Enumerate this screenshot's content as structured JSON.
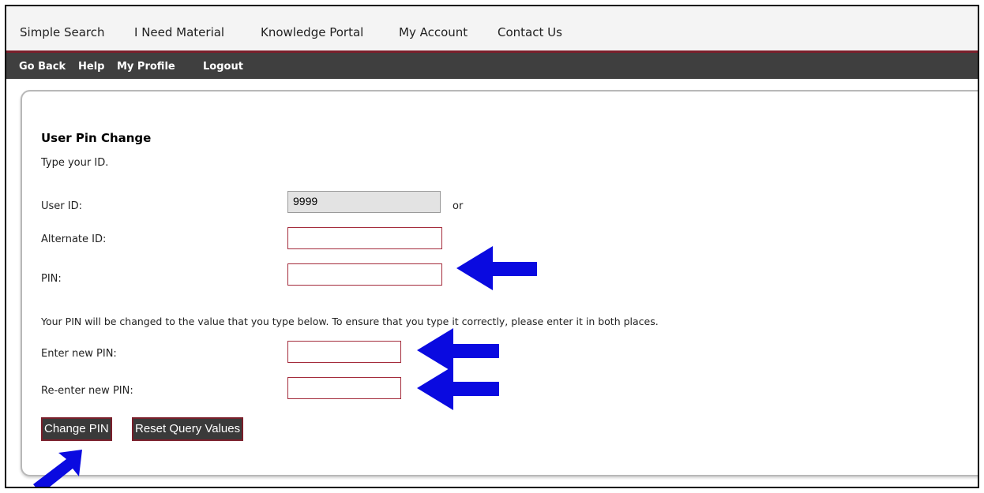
{
  "top_nav": [
    "Simple Search",
    "I Need Material",
    "Knowledge Portal",
    "My Account",
    "Contact Us"
  ],
  "sub_nav": [
    "Go Back",
    "Help",
    "My Profile",
    "Logout"
  ],
  "form": {
    "title": "User Pin Change",
    "instruction": "Type your ID.",
    "user_id_label": "User ID:",
    "user_id_value": "9999",
    "or_text": "or",
    "alternate_id_label": "Alternate ID:",
    "pin_label": "PIN:",
    "change_note": "Your PIN will be changed to the value that you type below. To ensure that you type it correctly, please enter it in both places.",
    "new_pin_label": "Enter new PIN:",
    "reenter_pin_label": "Re-enter new PIN:",
    "change_button": "Change PIN",
    "reset_button": "Reset Query Values"
  },
  "colors": {
    "arrow": "#0a0ae0",
    "accent": "#7a1f2b",
    "subnav_bg": "#3f3f3f"
  },
  "annotations": [
    "arrow-pin",
    "arrow-new-pin",
    "arrow-reenter-pin",
    "arrow-change-button"
  ]
}
